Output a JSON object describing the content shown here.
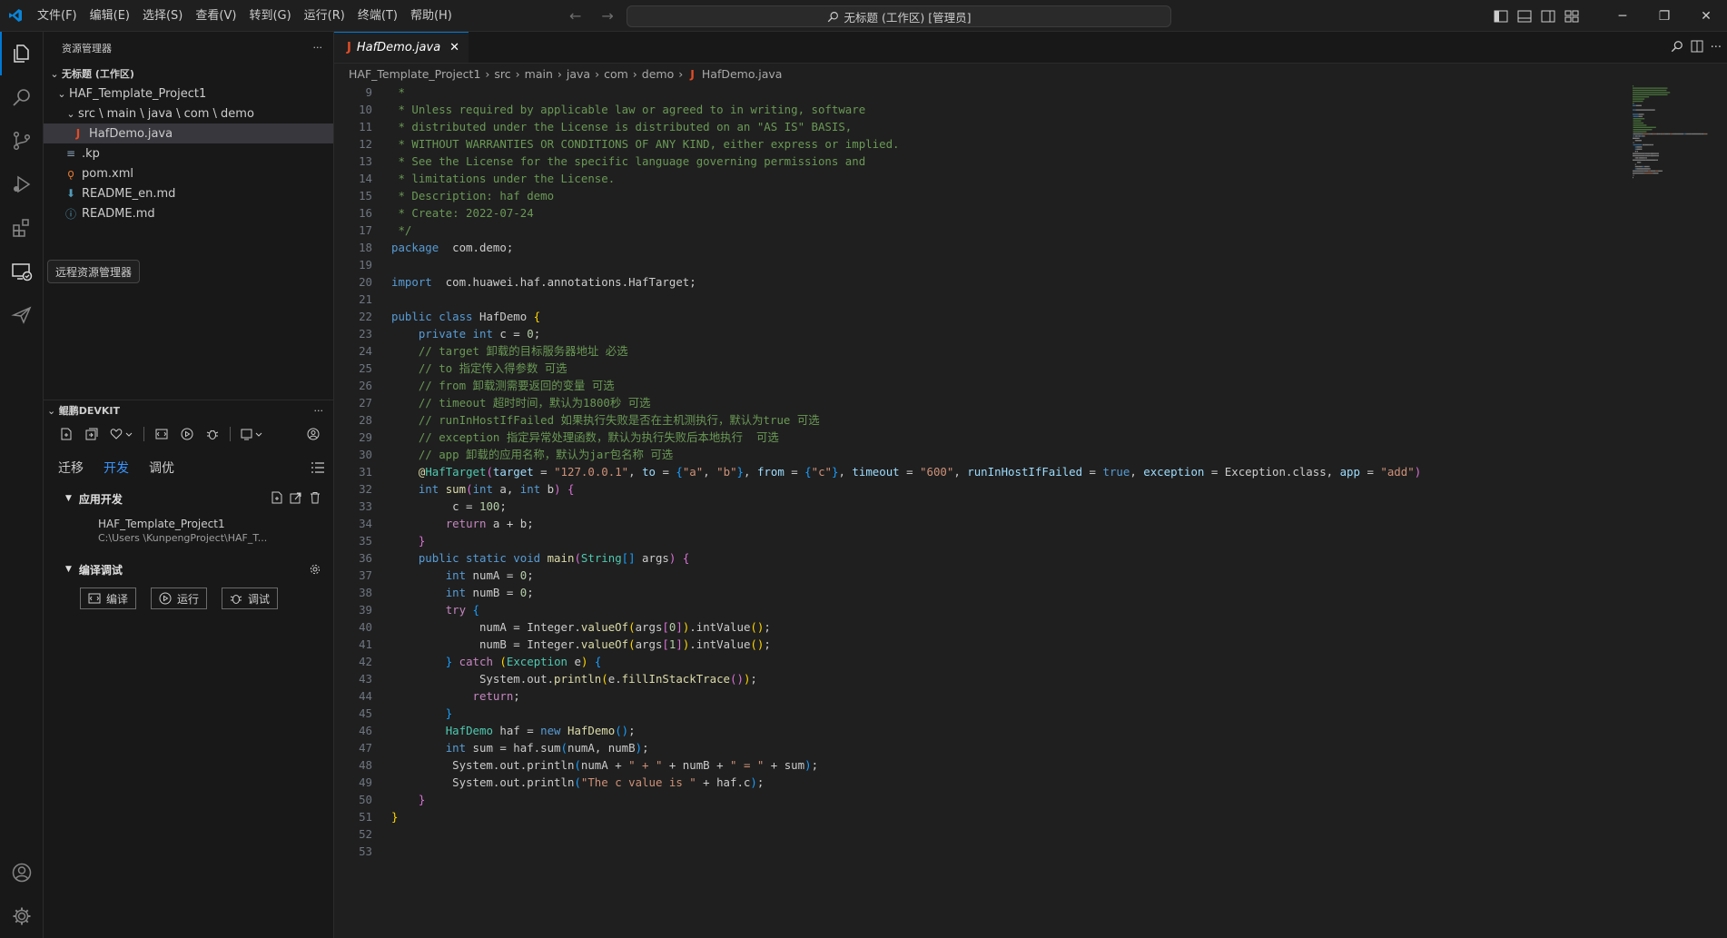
{
  "menu": [
    "文件(F)",
    "编辑(E)",
    "选择(S)",
    "查看(V)",
    "转到(G)",
    "运行(R)",
    "终端(T)",
    "帮助(H)"
  ],
  "command_center": "无标题 (工作区) [管理员]",
  "explorer": {
    "title": "资源管理器",
    "workspace": "无标题 (工作区)",
    "project": "HAF_Template_Project1",
    "folder": "src \\ main \\ java \\ com \\ demo",
    "files": [
      "HafDemo.java",
      ".kp",
      "pom.xml",
      "README_en.md",
      "README.md"
    ]
  },
  "tooltip": "远程资源管理器",
  "devkit": {
    "title": "鲲鹏DEVKIT",
    "tabs": [
      "迁移",
      "开发",
      "调优"
    ],
    "app_section": "应用开发",
    "project_name": "HAF_Template_Project1",
    "project_path": "C:\\Users                    \\KunpengProject\\HAF_T...",
    "build_section": "编译调试",
    "buttons": [
      "编译",
      "运行",
      "调试"
    ]
  },
  "editor": {
    "tab_label": "HafDemo.java",
    "breadcrumb": [
      "HAF_Template_Project1",
      "src",
      "main",
      "java",
      "com",
      "demo",
      "HafDemo.java"
    ]
  },
  "line_numbers": [
    "9",
    "10",
    "11",
    "12",
    "13",
    "14",
    "15",
    "16",
    "17",
    "18",
    "19",
    "20",
    "21",
    "22",
    "23",
    "24",
    "25",
    "26",
    "27",
    "28",
    "29",
    "30",
    "31",
    "32",
    "33",
    "34",
    "35",
    "36",
    "37",
    "38",
    "39",
    "40",
    "41",
    "42",
    "43",
    "44",
    "45",
    "46",
    "47",
    "48",
    "49",
    "50",
    "51",
    "52",
    "53"
  ],
  "code_lines": [
    [
      [
        "c",
        " *"
      ]
    ],
    [
      [
        "c",
        " * Unless required by applicable law or agreed to in writing, software"
      ]
    ],
    [
      [
        "c",
        " * distributed under the License is distributed on an \"AS IS\" BASIS,"
      ]
    ],
    [
      [
        "c",
        " * WITHOUT WARRANTIES OR CONDITIONS OF ANY KIND, either express or implied."
      ]
    ],
    [
      [
        "c",
        " * See the License for the specific language governing permissions and"
      ]
    ],
    [
      [
        "c",
        " * limitations under the License."
      ]
    ],
    [
      [
        "c",
        " * Description: haf demo"
      ]
    ],
    [
      [
        "c",
        " * Create: 2022-07-24"
      ]
    ],
    [
      [
        "c",
        " */"
      ]
    ],
    [
      [
        "k",
        "package"
      ],
      [
        "",
        "  com.demo;"
      ]
    ],
    [],
    [
      [
        "k",
        "import"
      ],
      [
        "",
        "  com.huawei.haf.annotations.HafTarget;"
      ]
    ],
    [],
    [
      [
        "k",
        "public class"
      ],
      [
        "",
        " HafDemo "
      ],
      [
        "y",
        "{"
      ]
    ],
    [
      [
        "",
        " "
      ],
      [
        "k",
        "private int"
      ],
      [
        "",
        " c = "
      ],
      [
        "n",
        "0"
      ],
      [
        "",
        ";"
      ]
    ],
    [
      [
        "",
        " "
      ],
      [
        "c",
        "// target 卸载的目标服务器地址 必选"
      ]
    ],
    [
      [
        "",
        " "
      ],
      [
        "c",
        "// to 指定传入得参数 可选"
      ]
    ],
    [
      [
        "",
        " "
      ],
      [
        "c",
        "// from 卸载测需要返回的变量 可选"
      ]
    ],
    [
      [
        "",
        " "
      ],
      [
        "c",
        "// timeout 超时时间，默认为1800秒 可选"
      ]
    ],
    [
      [
        "",
        " "
      ],
      [
        "c",
        "// runInHostIfFailed 如果执行失败是否在主机测执行，默认为true 可选"
      ]
    ],
    [
      [
        "",
        " "
      ],
      [
        "c",
        "// exception 指定异常处理函数，默认为执行失败后本地执行  可选"
      ]
    ],
    [
      [
        "",
        " "
      ],
      [
        "c",
        "// app 卸载的应用名称，默认为jar包名称 可选"
      ]
    ],
    [
      [
        "",
        " "
      ],
      [
        "f",
        "@"
      ],
      [
        "t",
        "HafTarget"
      ],
      [
        "p",
        "("
      ],
      [
        "v",
        "target"
      ],
      [
        "",
        " = "
      ],
      [
        "s",
        "\"127.0.0.1\""
      ],
      [
        "",
        ", "
      ],
      [
        "v",
        "to"
      ],
      [
        "",
        " = "
      ],
      [
        "b",
        "{"
      ],
      [
        "s",
        "\"a\""
      ],
      [
        "",
        ", "
      ],
      [
        "s",
        "\"b\""
      ],
      [
        "b",
        "}"
      ],
      [
        "",
        ", "
      ],
      [
        "v",
        "from"
      ],
      [
        "",
        " = "
      ],
      [
        "b",
        "{"
      ],
      [
        "s",
        "\"c\""
      ],
      [
        "b",
        "}"
      ],
      [
        "",
        ", "
      ],
      [
        "v",
        "timeout"
      ],
      [
        "",
        " = "
      ],
      [
        "s",
        "\"600\""
      ],
      [
        "",
        ", "
      ],
      [
        "v",
        "runInHostIfFailed"
      ],
      [
        "",
        " = "
      ],
      [
        "k",
        "true"
      ],
      [
        "",
        ", "
      ],
      [
        "v",
        "exception"
      ],
      [
        "",
        " = Exception.class, "
      ],
      [
        "v",
        "app"
      ],
      [
        "",
        " = "
      ],
      [
        "s",
        "\"add\""
      ],
      [
        "p",
        ")"
      ]
    ],
    [
      [
        "",
        " "
      ],
      [
        "k",
        "int"
      ],
      [
        "",
        " "
      ],
      [
        "f",
        "sum"
      ],
      [
        "p",
        "("
      ],
      [
        "k",
        "int"
      ],
      [
        "",
        " a, "
      ],
      [
        "k",
        "int"
      ],
      [
        "",
        " b"
      ],
      [
        "p",
        ")"
      ],
      [
        "",
        " "
      ],
      [
        "p",
        "{"
      ]
    ],
    [
      [
        "",
        "     c = "
      ],
      [
        "n",
        "100"
      ],
      [
        "",
        ";"
      ]
    ],
    [
      [
        "",
        "     "
      ],
      [
        "kc",
        "return"
      ],
      [
        "",
        " a + b;"
      ]
    ],
    [
      [
        "",
        " "
      ],
      [
        "p",
        "}"
      ]
    ],
    [
      [
        "",
        " "
      ],
      [
        "k",
        "public static void"
      ],
      [
        "",
        " "
      ],
      [
        "f",
        "main"
      ],
      [
        "p",
        "("
      ],
      [
        "t",
        "String"
      ],
      [
        "b",
        "[]"
      ],
      [
        "",
        " args"
      ],
      [
        "p",
        ")"
      ],
      [
        "",
        " "
      ],
      [
        "p",
        "{"
      ]
    ],
    [
      [
        "",
        "     "
      ],
      [
        "k",
        "int"
      ],
      [
        "",
        " numA = "
      ],
      [
        "n",
        "0"
      ],
      [
        "",
        ";"
      ]
    ],
    [
      [
        "",
        "     "
      ],
      [
        "k",
        "int"
      ],
      [
        "",
        " numB = "
      ],
      [
        "n",
        "0"
      ],
      [
        "",
        ";"
      ]
    ],
    [
      [
        "",
        "     "
      ],
      [
        "kc",
        "try"
      ],
      [
        "",
        " "
      ],
      [
        "b",
        "{"
      ]
    ],
    [
      [
        "",
        "         numA = Integer."
      ],
      [
        "f",
        "valueOf"
      ],
      [
        "y",
        "("
      ],
      [
        "",
        "args"
      ],
      [
        "p",
        "["
      ],
      [
        "n",
        "0"
      ],
      [
        "p",
        "]"
      ],
      [
        "y",
        ")"
      ],
      [
        "",
        ".intValue"
      ],
      [
        "y",
        "()"
      ],
      [
        "",
        ";"
      ]
    ],
    [
      [
        "",
        "         numB = Integer."
      ],
      [
        "f",
        "valueOf"
      ],
      [
        "y",
        "("
      ],
      [
        "",
        "args"
      ],
      [
        "p",
        "["
      ],
      [
        "n",
        "1"
      ],
      [
        "p",
        "]"
      ],
      [
        "y",
        ")"
      ],
      [
        "",
        ".intValue"
      ],
      [
        "y",
        "()"
      ],
      [
        "",
        ";"
      ]
    ],
    [
      [
        "",
        "     "
      ],
      [
        "b",
        "}"
      ],
      [
        "",
        " "
      ],
      [
        "kc",
        "catch"
      ],
      [
        "",
        " "
      ],
      [
        "y",
        "("
      ],
      [
        "t",
        "Exception"
      ],
      [
        "",
        " e"
      ],
      [
        "y",
        ")"
      ],
      [
        "",
        " "
      ],
      [
        "b",
        "{"
      ]
    ],
    [
      [
        "",
        "         System.out."
      ],
      [
        "f",
        "println"
      ],
      [
        "y",
        "("
      ],
      [
        "",
        "e."
      ],
      [
        "f",
        "fillInStackTrace"
      ],
      [
        "p",
        "()"
      ],
      [
        "y",
        ")"
      ],
      [
        "",
        ";"
      ]
    ],
    [
      [
        "",
        "         "
      ],
      [
        "kc",
        "return"
      ],
      [
        "",
        ";"
      ]
    ],
    [
      [
        "",
        "     "
      ],
      [
        "b",
        "}"
      ]
    ],
    [
      [
        "",
        "     "
      ],
      [
        "t",
        "HafDemo"
      ],
      [
        "",
        " haf = "
      ],
      [
        "k",
        "new"
      ],
      [
        "",
        " "
      ],
      [
        "f",
        "HafDemo"
      ],
      [
        "b",
        "()"
      ],
      [
        "",
        ";"
      ]
    ],
    [
      [
        "",
        "     "
      ],
      [
        "k",
        "int"
      ],
      [
        "",
        " sum = haf.sum"
      ],
      [
        "b",
        "("
      ],
      [
        "",
        "numA, numB"
      ],
      [
        "b",
        ")"
      ],
      [
        "",
        ";"
      ]
    ],
    [
      [
        "",
        "     System.out.println"
      ],
      [
        "b",
        "("
      ],
      [
        "",
        "numA + "
      ],
      [
        "s",
        "\" + \""
      ],
      [
        "",
        " + numB + "
      ],
      [
        "s",
        "\" = \""
      ],
      [
        "",
        " + sum"
      ],
      [
        "b",
        ")"
      ],
      [
        "",
        ";"
      ]
    ],
    [
      [
        "",
        "     System.out.println"
      ],
      [
        "b",
        "("
      ],
      [
        "s",
        "\"The c value is \""
      ],
      [
        "",
        " + haf.c"
      ],
      [
        "b",
        ")"
      ],
      [
        "",
        ";"
      ]
    ],
    [
      [
        "",
        " "
      ],
      [
        "p",
        "}"
      ]
    ],
    [
      [
        "y",
        "}"
      ]
    ],
    [],
    []
  ]
}
